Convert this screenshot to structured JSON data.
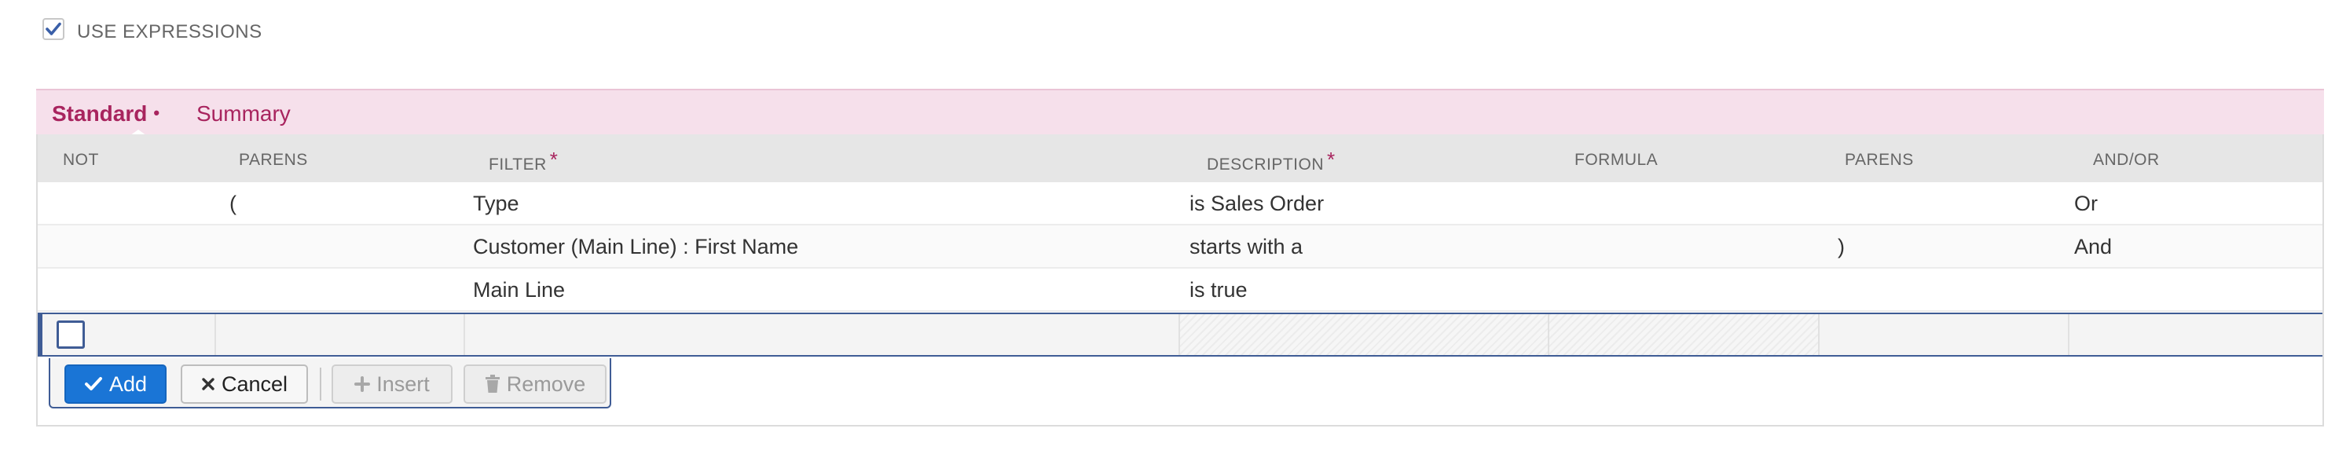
{
  "use_expressions": {
    "label": "USE EXPRESSIONS",
    "checked": true
  },
  "tabs": [
    {
      "label": "Standard",
      "marker": "•",
      "active": true
    },
    {
      "label": "Summary",
      "active": false
    }
  ],
  "columns": [
    {
      "label": "NOT",
      "required": false
    },
    {
      "label": "PARENS",
      "required": false
    },
    {
      "label": "FILTER",
      "required": true
    },
    {
      "label": "DESCRIPTION",
      "required": true
    },
    {
      "label": "FORMULA",
      "required": false
    },
    {
      "label": "PARENS",
      "required": false
    },
    {
      "label": "AND/OR",
      "required": false
    }
  ],
  "required_marker": "*",
  "rows": [
    {
      "not": "",
      "open_parens": "(",
      "filter": "Type",
      "description": "is Sales Order",
      "formula": "",
      "close_parens": "",
      "and_or": "Or"
    },
    {
      "not": "",
      "open_parens": "",
      "filter": "Customer (Main Line) : First Name",
      "description": "starts with a",
      "formula": "",
      "close_parens": ")",
      "and_or": "And"
    },
    {
      "not": "",
      "open_parens": "",
      "filter": "Main Line",
      "description": "is true",
      "formula": "",
      "close_parens": "",
      "and_or": ""
    }
  ],
  "buttons": {
    "add": "Add",
    "cancel": "Cancel",
    "insert": "Insert",
    "remove": "Remove"
  },
  "colors": {
    "accent": "#a8245e",
    "tab_bar_bg": "#f6e0eb",
    "primary_button": "#1a75d6",
    "edit_row_border": "#3f5c95",
    "header_bg": "#e6e6e6"
  },
  "icons": {
    "checkbox_checked": "check-icon",
    "add": "check-icon",
    "cancel": "x-icon",
    "insert": "plus-icon",
    "remove": "trash-icon"
  }
}
